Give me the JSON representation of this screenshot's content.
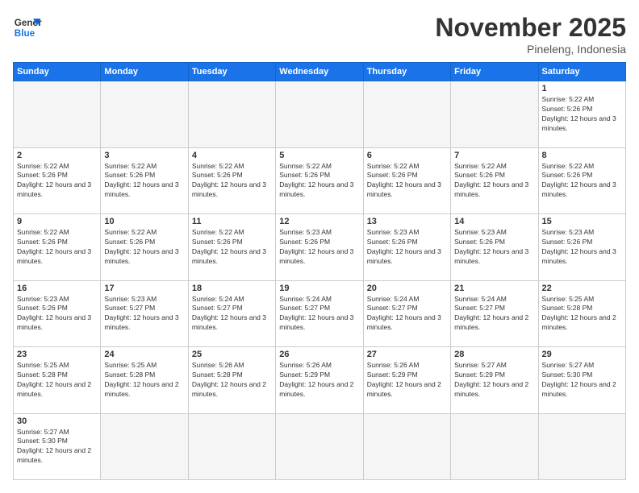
{
  "logo": {
    "text_general": "General",
    "text_blue": "Blue"
  },
  "header": {
    "title": "November 2025",
    "subtitle": "Pineleng, Indonesia"
  },
  "weekdays": [
    "Sunday",
    "Monday",
    "Tuesday",
    "Wednesday",
    "Thursday",
    "Friday",
    "Saturday"
  ],
  "weeks": [
    [
      {
        "day": "",
        "info": ""
      },
      {
        "day": "",
        "info": ""
      },
      {
        "day": "",
        "info": ""
      },
      {
        "day": "",
        "info": ""
      },
      {
        "day": "",
        "info": ""
      },
      {
        "day": "",
        "info": ""
      },
      {
        "day": "1",
        "info": "Sunrise: 5:22 AM\nSunset: 5:26 PM\nDaylight: 12 hours and 3 minutes."
      }
    ],
    [
      {
        "day": "2",
        "info": "Sunrise: 5:22 AM\nSunset: 5:26 PM\nDaylight: 12 hours and 3 minutes."
      },
      {
        "day": "3",
        "info": "Sunrise: 5:22 AM\nSunset: 5:26 PM\nDaylight: 12 hours and 3 minutes."
      },
      {
        "day": "4",
        "info": "Sunrise: 5:22 AM\nSunset: 5:26 PM\nDaylight: 12 hours and 3 minutes."
      },
      {
        "day": "5",
        "info": "Sunrise: 5:22 AM\nSunset: 5:26 PM\nDaylight: 12 hours and 3 minutes."
      },
      {
        "day": "6",
        "info": "Sunrise: 5:22 AM\nSunset: 5:26 PM\nDaylight: 12 hours and 3 minutes."
      },
      {
        "day": "7",
        "info": "Sunrise: 5:22 AM\nSunset: 5:26 PM\nDaylight: 12 hours and 3 minutes."
      },
      {
        "day": "8",
        "info": "Sunrise: 5:22 AM\nSunset: 5:26 PM\nDaylight: 12 hours and 3 minutes."
      }
    ],
    [
      {
        "day": "9",
        "info": "Sunrise: 5:22 AM\nSunset: 5:26 PM\nDaylight: 12 hours and 3 minutes."
      },
      {
        "day": "10",
        "info": "Sunrise: 5:22 AM\nSunset: 5:26 PM\nDaylight: 12 hours and 3 minutes."
      },
      {
        "day": "11",
        "info": "Sunrise: 5:22 AM\nSunset: 5:26 PM\nDaylight: 12 hours and 3 minutes."
      },
      {
        "day": "12",
        "info": "Sunrise: 5:23 AM\nSunset: 5:26 PM\nDaylight: 12 hours and 3 minutes."
      },
      {
        "day": "13",
        "info": "Sunrise: 5:23 AM\nSunset: 5:26 PM\nDaylight: 12 hours and 3 minutes."
      },
      {
        "day": "14",
        "info": "Sunrise: 5:23 AM\nSunset: 5:26 PM\nDaylight: 12 hours and 3 minutes."
      },
      {
        "day": "15",
        "info": "Sunrise: 5:23 AM\nSunset: 5:26 PM\nDaylight: 12 hours and 3 minutes."
      }
    ],
    [
      {
        "day": "16",
        "info": "Sunrise: 5:23 AM\nSunset: 5:26 PM\nDaylight: 12 hours and 3 minutes."
      },
      {
        "day": "17",
        "info": "Sunrise: 5:23 AM\nSunset: 5:27 PM\nDaylight: 12 hours and 3 minutes."
      },
      {
        "day": "18",
        "info": "Sunrise: 5:24 AM\nSunset: 5:27 PM\nDaylight: 12 hours and 3 minutes."
      },
      {
        "day": "19",
        "info": "Sunrise: 5:24 AM\nSunset: 5:27 PM\nDaylight: 12 hours and 3 minutes."
      },
      {
        "day": "20",
        "info": "Sunrise: 5:24 AM\nSunset: 5:27 PM\nDaylight: 12 hours and 3 minutes."
      },
      {
        "day": "21",
        "info": "Sunrise: 5:24 AM\nSunset: 5:27 PM\nDaylight: 12 hours and 2 minutes."
      },
      {
        "day": "22",
        "info": "Sunrise: 5:25 AM\nSunset: 5:28 PM\nDaylight: 12 hours and 2 minutes."
      }
    ],
    [
      {
        "day": "23",
        "info": "Sunrise: 5:25 AM\nSunset: 5:28 PM\nDaylight: 12 hours and 2 minutes."
      },
      {
        "day": "24",
        "info": "Sunrise: 5:25 AM\nSunset: 5:28 PM\nDaylight: 12 hours and 2 minutes."
      },
      {
        "day": "25",
        "info": "Sunrise: 5:26 AM\nSunset: 5:28 PM\nDaylight: 12 hours and 2 minutes."
      },
      {
        "day": "26",
        "info": "Sunrise: 5:26 AM\nSunset: 5:29 PM\nDaylight: 12 hours and 2 minutes."
      },
      {
        "day": "27",
        "info": "Sunrise: 5:26 AM\nSunset: 5:29 PM\nDaylight: 12 hours and 2 minutes."
      },
      {
        "day": "28",
        "info": "Sunrise: 5:27 AM\nSunset: 5:29 PM\nDaylight: 12 hours and 2 minutes."
      },
      {
        "day": "29",
        "info": "Sunrise: 5:27 AM\nSunset: 5:30 PM\nDaylight: 12 hours and 2 minutes."
      }
    ],
    [
      {
        "day": "30",
        "info": "Sunrise: 5:27 AM\nSunset: 5:30 PM\nDaylight: 12 hours and 2 minutes."
      },
      {
        "day": "",
        "info": ""
      },
      {
        "day": "",
        "info": ""
      },
      {
        "day": "",
        "info": ""
      },
      {
        "day": "",
        "info": ""
      },
      {
        "day": "",
        "info": ""
      },
      {
        "day": "",
        "info": ""
      }
    ]
  ]
}
